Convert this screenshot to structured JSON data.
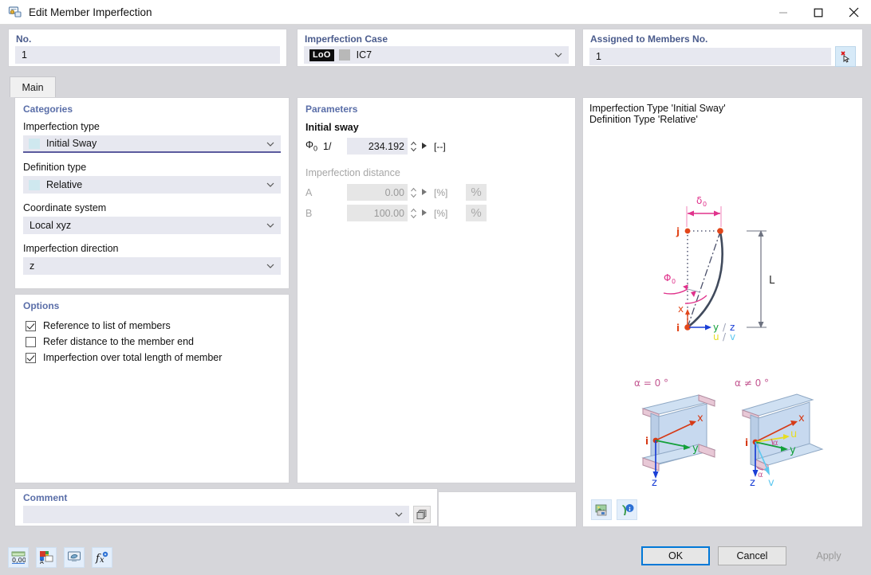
{
  "window": {
    "title": "Edit Member Imperfection",
    "icon": "member-imperfection-icon",
    "minimize": "—",
    "maximize": "□",
    "close": "✕"
  },
  "top": {
    "no": {
      "label": "No.",
      "value": "1"
    },
    "imperfection_case": {
      "label": "Imperfection Case",
      "badge": "LoO",
      "value": "IC7",
      "chevron": "chevron-down-icon"
    },
    "assigned": {
      "label": "Assigned to Members No.",
      "value": "1",
      "pick_button": "pick-members-icon"
    }
  },
  "tabs": [
    {
      "label": "Main",
      "active": true
    }
  ],
  "categories": {
    "title": "Categories",
    "fields": [
      {
        "label": "Imperfection type",
        "value": "Initial Sway",
        "name": "imperfection-type"
      },
      {
        "label": "Definition type",
        "value": "Relative",
        "name": "definition-type"
      },
      {
        "label": "Coordinate system",
        "value": "Local xyz",
        "name": "coordinate-system"
      },
      {
        "label": "Imperfection direction",
        "value": "z",
        "name": "imperfection-direction"
      }
    ]
  },
  "options": {
    "title": "Options",
    "items": [
      {
        "label": "Reference to list of members",
        "checked": true
      },
      {
        "label": "Refer distance to the member end",
        "checked": false
      },
      {
        "label": "Imperfection over total length of member",
        "checked": true
      }
    ]
  },
  "parameters": {
    "title": "Parameters",
    "initial_sway": {
      "group_label": "Initial sway",
      "symbol": "Φ",
      "subscript": "0",
      "prefix": "1/",
      "value": "234.192",
      "unit": "[--]"
    },
    "imperfection_distance": {
      "group_label": "Imperfection distance",
      "rows": [
        {
          "label": "A",
          "value": "0.00",
          "unit": "[%]",
          "pct": "%"
        },
        {
          "label": "B",
          "value": "100.00",
          "unit": "[%]",
          "pct": "%"
        }
      ]
    }
  },
  "preview": {
    "caption_line1": "Imperfection Type 'Initial Sway'",
    "caption_line2": "Definition Type 'Relative'",
    "diagram": {
      "delta_label": "δ",
      "delta_sub": "0",
      "phi_label": "Φ",
      "phi_sub": "0",
      "length_label": "L",
      "node_start": "i",
      "node_end": "j",
      "axis_x": "x",
      "axis_yz": "y / z",
      "axis_uv": "u / v"
    },
    "beam_left": {
      "title": "α = 0 °",
      "origin": "i",
      "x": "x",
      "y": "y",
      "z": "z"
    },
    "beam_right": {
      "title": "α ≠ 0 °",
      "origin": "i",
      "x": "x",
      "y": "y",
      "z": "z",
      "u": "u",
      "v": "v",
      "alpha1": "α",
      "alpha2": "α"
    },
    "buttons": [
      {
        "name": "image-export-icon"
      },
      {
        "name": "info-help-icon"
      }
    ]
  },
  "comment": {
    "label": "Comment",
    "value": "",
    "chevron": "chevron-down-icon",
    "clipboard_button": "comment-list-icon"
  },
  "bottom": {
    "toolbar": [
      {
        "name": "units-decimal-icon",
        "label": "0,00"
      },
      {
        "name": "rename-object-icon",
        "label": ""
      },
      {
        "name": "display-settings-icon",
        "label": ""
      },
      {
        "name": "formula-fx-icon",
        "label": ""
      }
    ],
    "ok": "OK",
    "cancel": "Cancel",
    "apply": "Apply"
  },
  "colors": {
    "accent": "#0078d7",
    "group_label": "#4a5b8c",
    "field_bg": "#e7e8f0",
    "dialog_bg": "#d6d6da",
    "diagram_pink": "#e0338c",
    "diagram_red": "#d63a16",
    "diagram_blue": "#1a3fd6",
    "diagram_green": "#13a03a",
    "diagram_dark": "#404a5c"
  }
}
